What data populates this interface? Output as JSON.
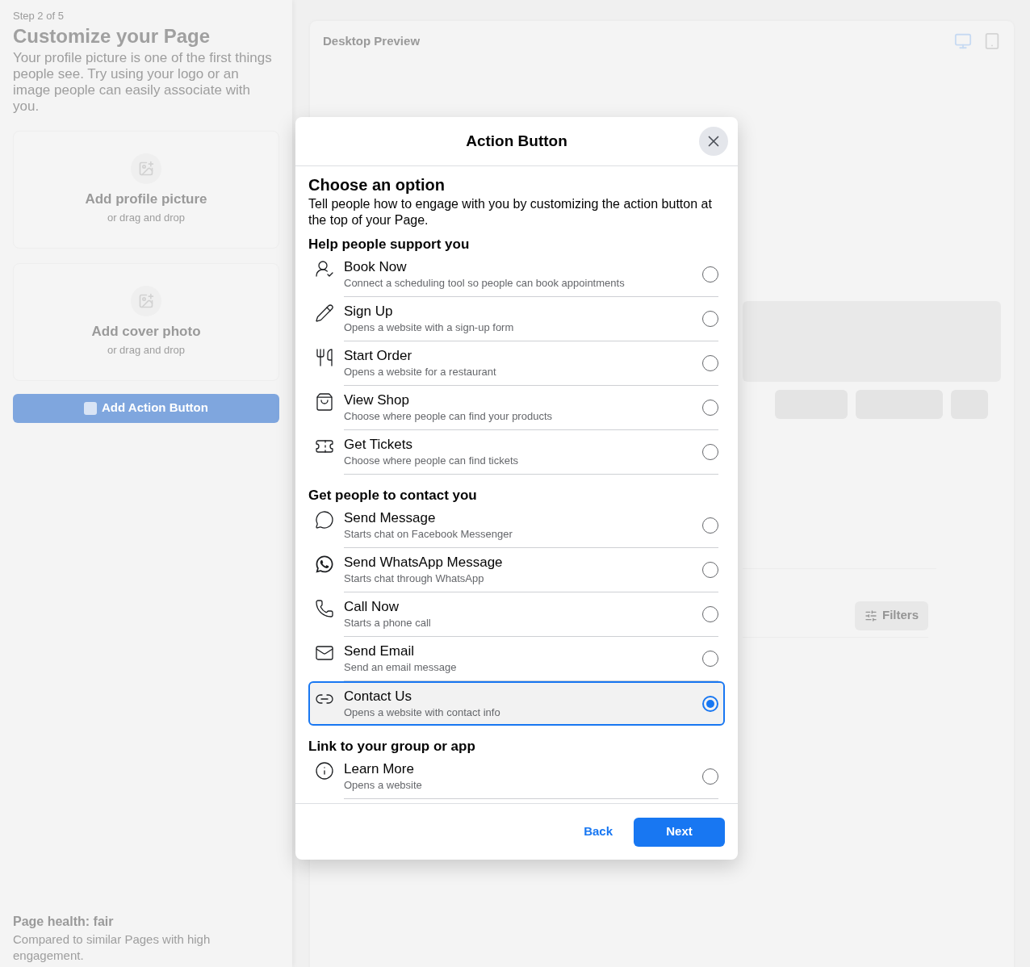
{
  "left_panel": {
    "step": "Step 2 of 5",
    "title": "Customize your Page",
    "description": "Your profile picture is one of the first things people see. Try using your logo or an image people can easily associate with you.",
    "uploads": [
      {
        "label": "Add profile picture",
        "hint": "or drag and drop"
      },
      {
        "label": "Add cover photo",
        "hint": "or drag and drop"
      }
    ],
    "action_button": "Add Action Button",
    "health": {
      "title": "Page health: fair",
      "description": "Compared to similar Pages with high engagement."
    }
  },
  "preview": {
    "title": "Desktop Preview",
    "devices": [
      {
        "kind": "desktop",
        "selected": true
      },
      {
        "kind": "tablet",
        "selected": false
      }
    ],
    "filters_button": "Filters"
  },
  "modal": {
    "title": "Action Button",
    "heading": "Choose an option",
    "description": "Tell people how to engage with you by customizing the action button at the top of your Page.",
    "sections": [
      {
        "title": "Help people support you",
        "options": [
          {
            "title": "Book Now",
            "subtitle": "Connect a scheduling tool so people can book appointments",
            "selected": false
          },
          {
            "title": "Sign Up",
            "subtitle": "Opens a website with a sign-up form",
            "selected": false
          },
          {
            "title": "Start Order",
            "subtitle": "Opens a website for a restaurant",
            "selected": false
          },
          {
            "title": "View Shop",
            "subtitle": "Choose where people can find your products",
            "selected": false
          },
          {
            "title": "Get Tickets",
            "subtitle": "Choose where people can find tickets",
            "selected": false
          }
        ]
      },
      {
        "title": "Get people to contact you",
        "options": [
          {
            "title": "Send Message",
            "subtitle": "Starts chat on Facebook Messenger",
            "selected": false
          },
          {
            "title": "Send WhatsApp Message",
            "subtitle": "Starts chat through WhatsApp",
            "selected": false
          },
          {
            "title": "Call Now",
            "subtitle": "Starts a phone call",
            "selected": false
          },
          {
            "title": "Send Email",
            "subtitle": "Send an email message",
            "selected": false
          },
          {
            "title": "Contact Us",
            "subtitle": "Opens a website with contact info",
            "selected": true
          }
        ]
      },
      {
        "title": "Link to your group or app",
        "options": [
          {
            "title": "Learn More",
            "subtitle": "Opens a website",
            "selected": false
          }
        ]
      }
    ],
    "back": "Back",
    "next": "Next"
  }
}
